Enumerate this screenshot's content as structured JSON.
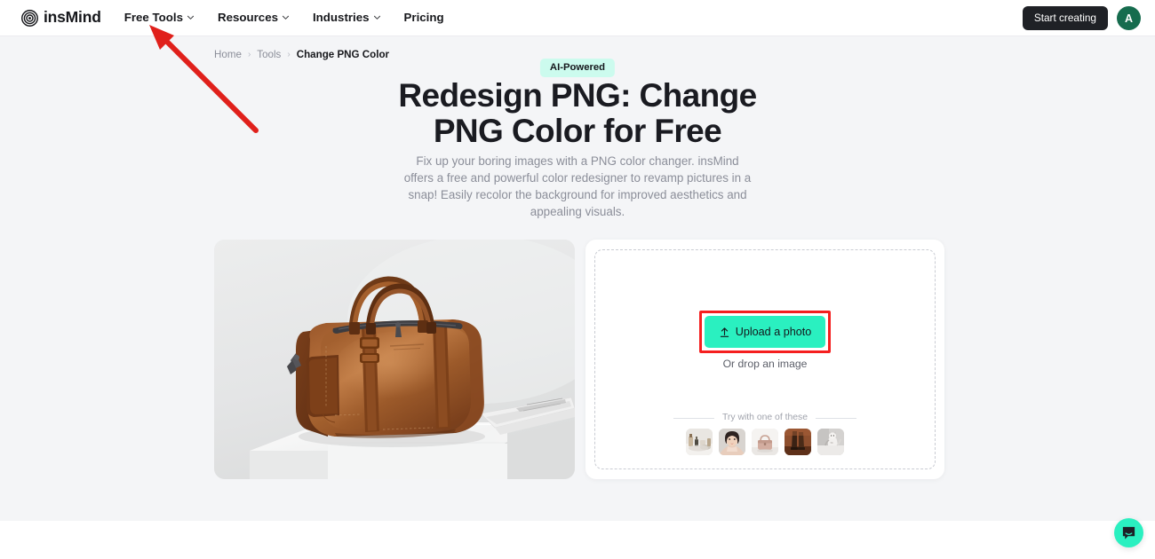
{
  "navbar": {
    "logo": {
      "text": "insMind",
      "icon": "concentric-circles-icon"
    },
    "links": [
      {
        "label": "Free Tools",
        "has_dropdown": true
      },
      {
        "label": "Resources",
        "has_dropdown": true
      },
      {
        "label": "Industries",
        "has_dropdown": true
      },
      {
        "label": "Pricing",
        "has_dropdown": false
      }
    ],
    "cta_label": "Start creating",
    "avatar_initial": "A"
  },
  "breadcrumb": {
    "items": [
      "Home",
      "Tools",
      "Change PNG Color"
    ],
    "separator": "›"
  },
  "hero": {
    "badge": "AI-Powered",
    "title_line1": "Redesign PNG: Change",
    "title_line2": "PNG Color for Free",
    "description": "Fix up your boring images with a PNG color changer. insMind offers a free and powerful color redesigner to revamp pictures in a snap! Easily recolor the background for improved aesthetics and appealing visuals."
  },
  "preview": {
    "alt": "brown-leather-duffle-bag-on-white-pedestal"
  },
  "upload": {
    "button_label": "Upload a photo",
    "button_icon": "upload-arrow-icon",
    "drop_hint": "Or drop an image",
    "samples_label": "Try with one of these",
    "samples": [
      {
        "name": "cosmetics-bottles"
      },
      {
        "name": "woman-portrait"
      },
      {
        "name": "pink-handbag"
      },
      {
        "name": "brown-boots"
      },
      {
        "name": "cat"
      }
    ]
  },
  "annotation": {
    "arrow_color": "#e0201b",
    "target": "Free Tools"
  },
  "chat": {
    "icon": "chat-bubble-icon"
  },
  "colors": {
    "accent_mint": "#2af0c0",
    "badge_bg": "#ccfbee",
    "page_bg": "#f4f5f7",
    "dark": "#1f2126",
    "avatar_green": "#166c4e",
    "highlight_red": "#f51f1f"
  }
}
